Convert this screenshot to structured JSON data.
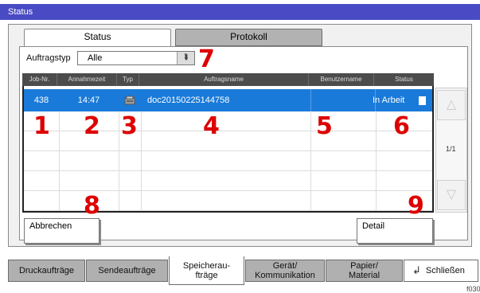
{
  "window": {
    "title": "Status"
  },
  "tabs": [
    {
      "label": "Status",
      "active": true
    },
    {
      "label": "Protokoll",
      "active": false
    }
  ],
  "filter": {
    "label": "Auftragstyp",
    "value": "Alle"
  },
  "table": {
    "columns": [
      "Job-Nr.",
      "Annahmezeit",
      "Typ",
      "Auftragsname",
      "Benutzername",
      "Status"
    ],
    "rows": [
      {
        "job_nr": "438",
        "time": "14:47",
        "type_icon": "document-box-icon",
        "name": "doc20150225144758",
        "user": "",
        "status": "In Arbeit"
      }
    ]
  },
  "pager": {
    "page": "1/1"
  },
  "buttons": {
    "cancel": "Abbrechen",
    "detail": "Detail"
  },
  "callouts": {
    "c1": "1",
    "c2": "2",
    "c3": "3",
    "c4": "4",
    "c5": "5",
    "c6": "6",
    "c7": "7",
    "c8": "8",
    "c9": "9"
  },
  "bottom_tabs": [
    {
      "label": "Druckaufträge"
    },
    {
      "label": "Sendeaufträge"
    },
    {
      "label": "Speicherau- fträge",
      "active": true
    },
    {
      "label": "Gerät/ Kommunikation"
    },
    {
      "label": "Papier/ Material"
    },
    {
      "label": "Schließen"
    }
  ],
  "footnote": "f030",
  "colors": {
    "titlebar": "#4a4ac4",
    "selected_row": "#1a7ad9",
    "callout": "#dd0000"
  }
}
